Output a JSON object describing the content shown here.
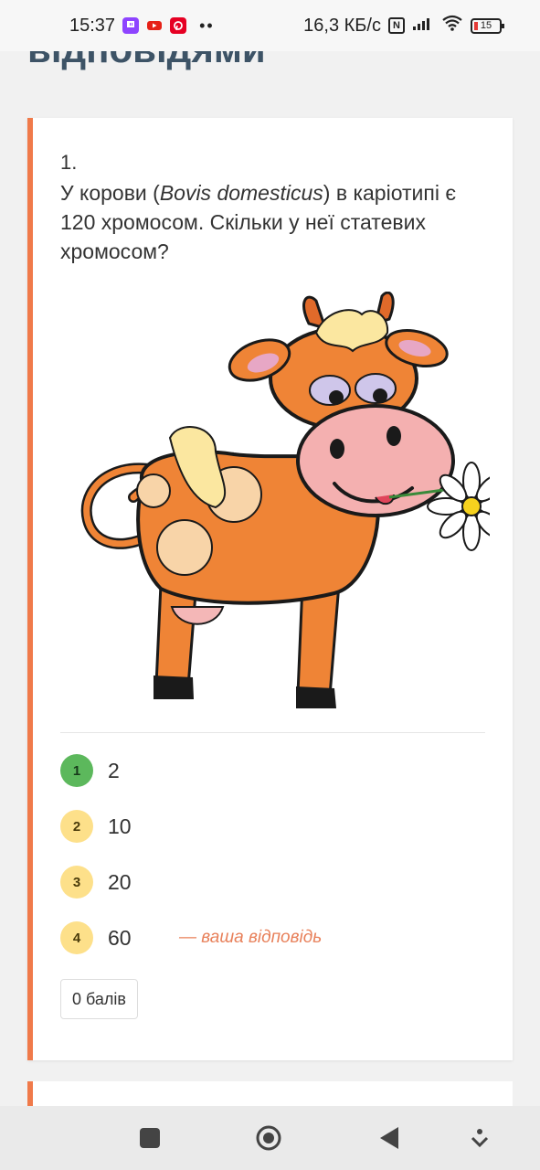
{
  "status_bar": {
    "time": "15:37",
    "app_icons": [
      "twitch-icon",
      "youtube-icon",
      "pinterest-icon"
    ],
    "more": "••",
    "speed": "16,3 КБ/с",
    "battery": "15"
  },
  "page": {
    "heading": "відповідями"
  },
  "question": {
    "number": "1.",
    "text_before": "У корови (",
    "species": "Bovis domesticus",
    "text_after": ") в каріотипі є 120 хромосом. Скільки у неї статевих хромосом?",
    "options": [
      {
        "index": "1",
        "value": "2",
        "state": "correct"
      },
      {
        "index": "2",
        "value": "10",
        "state": "neutral"
      },
      {
        "index": "3",
        "value": "20",
        "state": "neutral"
      },
      {
        "index": "4",
        "value": "60",
        "state": "neutral",
        "note": "— ваша відповідь"
      }
    ],
    "score": "0 балів"
  },
  "colors": {
    "accent": "#f07a4a",
    "correct": "#5cb85c",
    "neutral": "#fde08a",
    "heading": "#3d5366"
  }
}
